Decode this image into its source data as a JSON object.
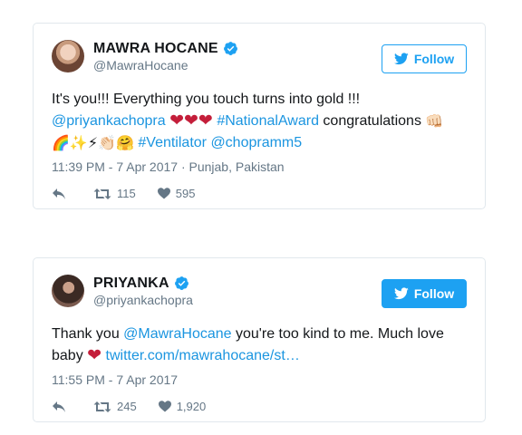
{
  "tweets": [
    {
      "name": "MAWRA HOCANE",
      "handle": "@MawraHocane",
      "follow_label": "Follow",
      "text": {
        "line1": "It's you!!! Everything you touch turns into gold !!!",
        "mention1": "@priyankachopra",
        "hearts": "❤❤❤",
        "hashtag1": "#NationalAward",
        "congrats": " congratulations ",
        "fist_emoji": "👊🏻",
        "emojis": "🌈✨⚡👏🏻🤗",
        "hashtag2": "#Ventilator",
        "mention2": "@chopramm5"
      },
      "timestamp": "11:39 PM - 7 Apr 2017",
      "location": " · Punjab, Pakistan",
      "retweets": "115",
      "likes": "595"
    },
    {
      "name": "PRIYANKA",
      "handle": "@priyankachopra",
      "follow_label": "Follow",
      "text": {
        "part1": "Thank you ",
        "mention": "@MawraHocane",
        "part2": " you're too kind to me. Much love baby ",
        "heart": "❤",
        "link": "twitter.com/mawrahocane/st…"
      },
      "timestamp": "11:55 PM - 7 Apr 2017",
      "retweets": "245",
      "likes": "1,920"
    }
  ],
  "colors": {
    "accent": "#1da1f2",
    "link": "#1b95e0",
    "muted": "#657786",
    "border": "#e1e8ed",
    "heart": "#c41e3a"
  },
  "icons": [
    "verified-icon",
    "twitter-bird-icon",
    "reply-icon",
    "retweet-icon",
    "like-icon"
  ]
}
